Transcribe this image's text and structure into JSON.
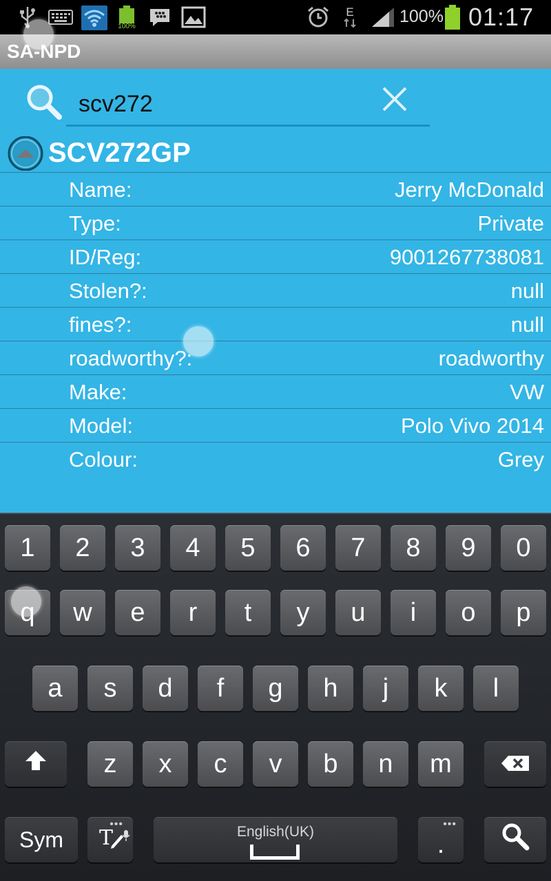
{
  "status_bar": {
    "battery_small_label": "100%",
    "network_type": "E",
    "battery_percent": "100%",
    "time": "01:17"
  },
  "app": {
    "title": "SA-NPD"
  },
  "search": {
    "value": "scv272"
  },
  "result": {
    "plate": "SCV272GP",
    "fields": [
      {
        "label": "Name:",
        "value": "Jerry McDonald"
      },
      {
        "label": "Type:",
        "value": "Private"
      },
      {
        "label": "ID/Reg:",
        "value": "9001267738081"
      },
      {
        "label": "Stolen?:",
        "value": "null"
      },
      {
        "label": "fines?:",
        "value": "null"
      },
      {
        "label": "roadworthy?:",
        "value": "roadworthy"
      },
      {
        "label": "Make:",
        "value": "VW"
      },
      {
        "label": "Model:",
        "value": "Polo Vivo 2014"
      },
      {
        "label": "Colour:",
        "value": "Grey"
      }
    ]
  },
  "keyboard": {
    "row_numbers": [
      "1",
      "2",
      "3",
      "4",
      "5",
      "6",
      "7",
      "8",
      "9",
      "0"
    ],
    "row_top": [
      "q",
      "w",
      "e",
      "r",
      "t",
      "y",
      "u",
      "i",
      "o",
      "p"
    ],
    "row_middle": [
      "a",
      "s",
      "d",
      "f",
      "g",
      "h",
      "j",
      "k",
      "l"
    ],
    "row_bottom": [
      "z",
      "x",
      "c",
      "v",
      "b",
      "n",
      "m"
    ],
    "sym_label": "Sym",
    "space_label": "English(UK)",
    "period_label": ".",
    "accent_color": "#33b5e5"
  }
}
